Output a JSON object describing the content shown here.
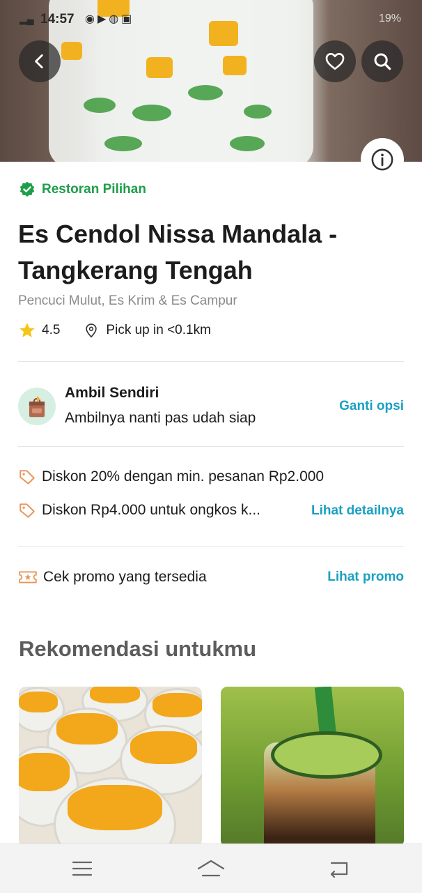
{
  "status_bar": {
    "time": "14:57",
    "battery": "19%"
  },
  "restaurant": {
    "badge": "Restoran Pilihan",
    "name": "Es Cendol Nissa Mandala - Tangkerang Tengah",
    "cuisine": "Pencuci Mulut, Es Krim & Es Campur",
    "rating": "4.5",
    "distance": "Pick up in <0.1km"
  },
  "pickup_option": {
    "title": "Ambil Sendiri",
    "subtitle": "Ambilnya nanti pas udah siap",
    "action": "Ganti opsi"
  },
  "discounts": {
    "items": [
      "Diskon 20% dengan min. pesanan Rp2.000",
      "Diskon Rp4.000 untuk ongkos k..."
    ],
    "action": "Lihat detailnya"
  },
  "promo": {
    "label": "Cek promo yang tersedia",
    "action": "Lihat promo"
  },
  "recommendations": {
    "title": "Rekomendasi untukmu"
  },
  "colors": {
    "green": "#1f9e4a",
    "link": "#1aa0c2",
    "star": "#f5c518",
    "promo_icon": "#e8955a"
  }
}
